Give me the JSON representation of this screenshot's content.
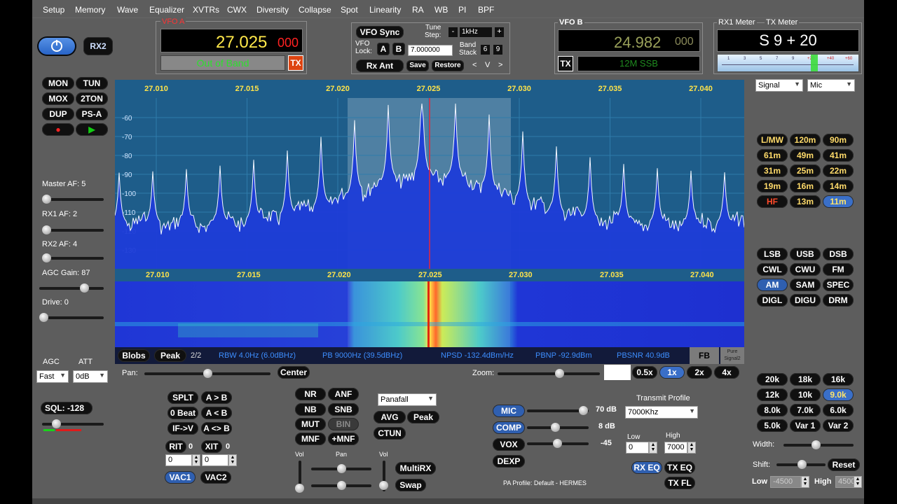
{
  "menu": [
    "Setup",
    "Memory",
    "Wave",
    "Equalizer",
    "XVTRs",
    "CWX",
    "Diversity",
    "Collapse",
    "Spot",
    "Linearity",
    "RA",
    "WB",
    "PI",
    "BPF"
  ],
  "power": {
    "rx2": "RX2"
  },
  "left_buttons": {
    "mon": "MON",
    "tun": "TUN",
    "mox": "MOX",
    "twoton": "2TON",
    "dup": "DUP",
    "psa": "PS-A"
  },
  "left_labels": {
    "master": "Master AF:  5",
    "rx1": "RX1 AF:  2",
    "rx2": "RX2 AF:  4",
    "agc": "AGC Gain:  87",
    "drive": "Drive:  0"
  },
  "agc": {
    "agc_label": "AGC",
    "att_label": "ATT",
    "agc_value": "Fast",
    "att_value": "0dB"
  },
  "sql": "SQL: -128",
  "vfoa": {
    "title": "VFO A",
    "freq": "27.025",
    "freq_small": "000",
    "status": "Out of Band",
    "tx": "TX"
  },
  "vfo_ctrl": {
    "sync": "VFO Sync",
    "tune_step": "Tune\nStep:",
    "step": "1kHz",
    "vfo_lock": "VFO\nLock:",
    "a": "A",
    "b": "B",
    "lock_val": "7.000000",
    "band_stack": "Band\nStack",
    "bs1": "6",
    "bs2": "9",
    "rx_ant": "Rx Ant",
    "save": "Save",
    "restore": "Restore",
    "lt": "<",
    "v": "V",
    "gt": ">"
  },
  "vfob": {
    "title": "VFO B",
    "freq": "24.982",
    "freq_small": "000",
    "tx": "TX",
    "mode": "12M SSB"
  },
  "meters": {
    "rx1": "RX1 Meter",
    "tx": "TX Meter",
    "reading": "S 9 + 20",
    "signal": "Signal",
    "mic": "Mic",
    "scale": [
      "1",
      "3",
      "5",
      "7",
      "9",
      "+20",
      "+40",
      "+60"
    ]
  },
  "freq_labels": [
    "27.010",
    "27.015",
    "27.020",
    "27.025",
    "27.030",
    "27.035",
    "27.040"
  ],
  "db_labels": [
    "-60",
    "-70",
    "-80",
    "-90",
    "-100",
    "-110",
    "-120",
    "-130"
  ],
  "info": {
    "blobs": "Blobs",
    "peak": "Peak",
    "page": "2/2",
    "rbw": "RBW 4.0Hz (6.0dBHz)",
    "pb": "PB 9000Hz (39.5dBHz)",
    "npsd": "NPSD -132.4dBm/Hz",
    "pbnp": "PBNP -92.9dBm",
    "pbsnr": "PBSNR 40.9dB",
    "fb": "FB",
    "pure": "Pure Signal2"
  },
  "pan": {
    "pan": "Pan:",
    "center": "Center",
    "zoom": "Zoom:",
    "z0": "0.5x",
    "z1": "1x",
    "z2": "2x",
    "z4": "4x"
  },
  "bands": [
    "L/MW",
    "120m",
    "90m",
    "61m",
    "49m",
    "41m",
    "31m",
    "25m",
    "22m",
    "19m",
    "16m",
    "14m",
    "HF",
    "13m",
    "11m"
  ],
  "modes": [
    "LSB",
    "USB",
    "DSB",
    "CWL",
    "CWU",
    "FM",
    "AM",
    "SAM",
    "SPEC",
    "DIGL",
    "DIGU",
    "DRM"
  ],
  "filters": [
    "20k",
    "18k",
    "16k",
    "12k",
    "10k",
    "9.0k",
    "8.0k",
    "7.0k",
    "6.0k",
    "5.0k",
    "Var 1",
    "Var 2"
  ],
  "filter_ctrl": {
    "width": "Width:",
    "shift": "Shift:",
    "reset": "Reset",
    "low": "Low",
    "high": "High",
    "low_val": "-4500",
    "high_val": "4500"
  },
  "splt": {
    "splt": "SPLT",
    "atob": "A > B",
    "zbeat": "0 Beat",
    "btoa": "A < B",
    "ifv": "IF->V",
    "swap": "A <> B",
    "rit": "RIT",
    "rit_v": "0",
    "xit": "XIT",
    "xit_v": "0",
    "rit_field": "0",
    "xit_field": "0",
    "vac1": "VAC1",
    "vac2": "VAC2"
  },
  "dsp": {
    "nr": "NR",
    "anf": "ANF",
    "nb": "NB",
    "snb": "SNB",
    "mut": "MUT",
    "bin": "BIN",
    "mnf": "MNF",
    "pmnf": "+MNF",
    "display": "Panafall",
    "avg": "AVG",
    "peak": "Peak",
    "ctun": "CTUN",
    "vol": "Vol",
    "pan": "Pan",
    "vol2": "Vol",
    "multirx": "MultiRX",
    "swap": "Swap"
  },
  "tx": {
    "mic": "MIC",
    "mic_v": "70 dB",
    "comp": "COMP",
    "comp_v": "8 dB",
    "vox": "VOX",
    "vox_v": "-45",
    "dexp": "DEXP",
    "profile_label": "Transmit Profile",
    "profile": "7000Khz",
    "low": "Low",
    "high": "High",
    "low_v": "0",
    "high_v": "7000",
    "rxeq": "RX EQ",
    "txeq": "TX EQ",
    "txfl": "TX FL",
    "pa": "PA Profile: Default - HERMES"
  }
}
